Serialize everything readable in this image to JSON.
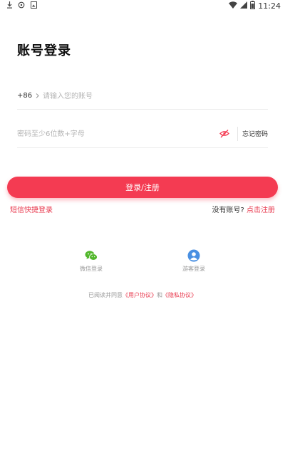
{
  "status_bar": {
    "left_icons": [
      "download-icon",
      "sync-icon",
      "image-icon"
    ],
    "right_icons": [
      "wifi-icon",
      "signal-icon",
      "battery-icon"
    ],
    "time": "11:24"
  },
  "login": {
    "title": "账号登录",
    "country_code": "+86",
    "phone_placeholder": "请输入您的账号",
    "password_placeholder": "密码至少6位数+字母",
    "forgot_label": "忘记密码",
    "submit_label": "登录/注册",
    "sms_login_label": "短信快捷登录",
    "no_account_label": "没有账号?",
    "register_label": "点击注册"
  },
  "social_login": {
    "wechat_label": "微信登录",
    "guest_label": "游客登录"
  },
  "agreement": {
    "prefix": "已阅读并同意",
    "user_agreement": "《用户协议》",
    "conjunction": "和",
    "privacy_policy": "《隐私协议》"
  },
  "colors": {
    "accent": "#f43b52",
    "link": "#e8394e",
    "wechat": "#52b72c",
    "guest": "#4a90e2"
  }
}
